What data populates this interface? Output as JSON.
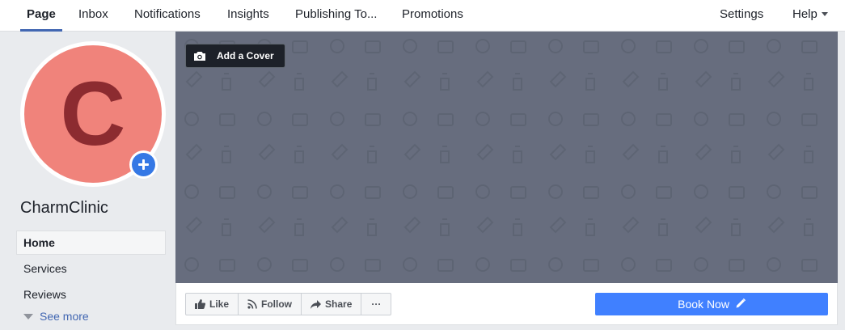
{
  "topnav": {
    "tabs": [
      {
        "label": "Page",
        "active": true
      },
      {
        "label": "Inbox",
        "active": false
      },
      {
        "label": "Notifications",
        "active": false
      },
      {
        "label": "Insights",
        "active": false
      },
      {
        "label": "Publishing To...",
        "active": false
      },
      {
        "label": "Promotions",
        "active": false
      }
    ],
    "settings_label": "Settings",
    "help_label": "Help"
  },
  "profile": {
    "initial": "C",
    "avatar_color": "#f0837b",
    "initial_color": "#8c2b30",
    "add_photo_icon": "plus-icon"
  },
  "page_name": "CharmClinic",
  "sidebar": {
    "items": [
      {
        "label": "Home",
        "active": true
      },
      {
        "label": "Services",
        "active": false
      },
      {
        "label": "Reviews",
        "active": false
      }
    ],
    "see_more_label": "See more"
  },
  "cover": {
    "add_cover_label": "Add a Cover",
    "camera_icon": "camera-icon",
    "background_color": "#676d7e"
  },
  "actions": {
    "like_label": "Like",
    "follow_label": "Follow",
    "share_label": "Share",
    "more_label": "···",
    "book_now_label": "Book Now",
    "book_now_color": "#4080ff"
  },
  "colors": {
    "accent": "#4267b2",
    "page_bg": "#e9ebee"
  }
}
